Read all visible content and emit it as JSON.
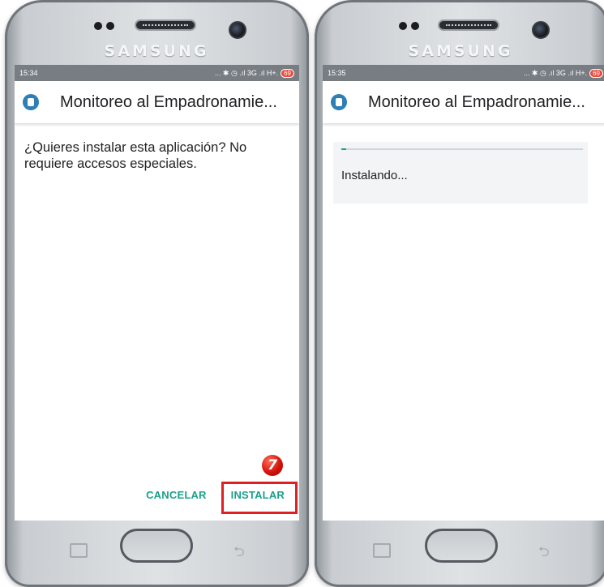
{
  "phones": [
    {
      "brand": "SAMSUNG",
      "status_time": "15:34",
      "status_icons": "... ✱ ◷ .ıl 3G .ıl H+.",
      "battery": "69",
      "app_title": "Monitoreo al Empadronamie...",
      "question": "¿Quieres instalar esta aplicación? No requiere accesos especiales.",
      "cancel_label": "CANCELAR",
      "install_label": "INSTALAR",
      "step_number": "7"
    },
    {
      "brand": "SAMSUNG",
      "status_time": "15:35",
      "status_icons": "... ✱ ◷ .ıl 3G .ıl H+.",
      "battery": "69",
      "app_title": "Monitoreo al Empadronamie...",
      "installing_text": "Instalando...",
      "progress_fraction": 0.02
    }
  ],
  "colors": {
    "accent": "#1aa08a",
    "highlight": "#e02020",
    "status_bar": "#777d82",
    "app_icon": "#2e7fb5"
  }
}
